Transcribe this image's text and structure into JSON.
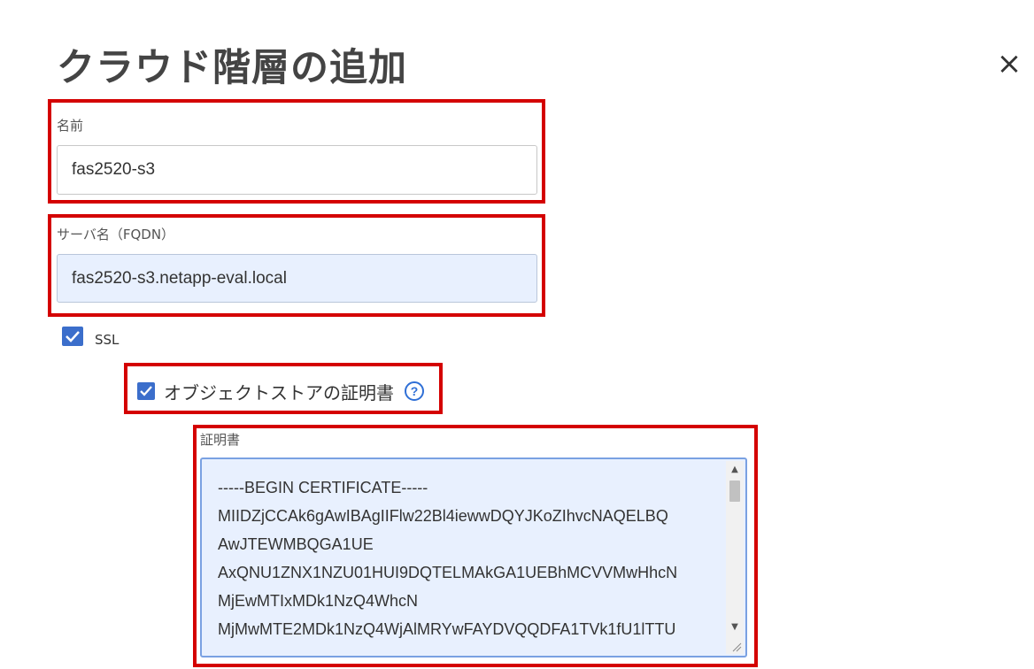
{
  "dialog": {
    "title": "クラウド階層の追加",
    "close_label": "×"
  },
  "form": {
    "name": {
      "label": "名前",
      "value": "fas2520-s3"
    },
    "server": {
      "label": "サーバ名（FQDN）",
      "value": "fas2520-s3.netapp-eval.local"
    },
    "ssl": {
      "label": "SSL",
      "checked": true
    },
    "object_store_cert": {
      "label": "オブジェクトストアの証明書",
      "checked": true,
      "help_icon": "question-circle-icon",
      "help_symbol": "?"
    },
    "certificate": {
      "label": "証明書",
      "lines": [
        "-----BEGIN CERTIFICATE-----",
        "MIIDZjCCAk6gAwIBAgIIFlw22Bl4iewwDQYJKoZIhvcNAQELBQ",
        "AwJTEWMBQGA1UE",
        "AxQNU1ZNX1NZU01HUI9DQTELMAkGA1UEBhMCVVMwHhcN",
        "MjEwMTIxMDk1NzQ4WhcN",
        "MjMwMTE2MDk1NzQ4WjAlMRYwFAYDVQQDFA1TVk1fU1lTTU"
      ]
    }
  },
  "colors": {
    "highlight": "#d40000",
    "checkbox": "#3b6ecb",
    "autofill_bg": "#e8f0fe",
    "help": "#2f6fd6"
  }
}
